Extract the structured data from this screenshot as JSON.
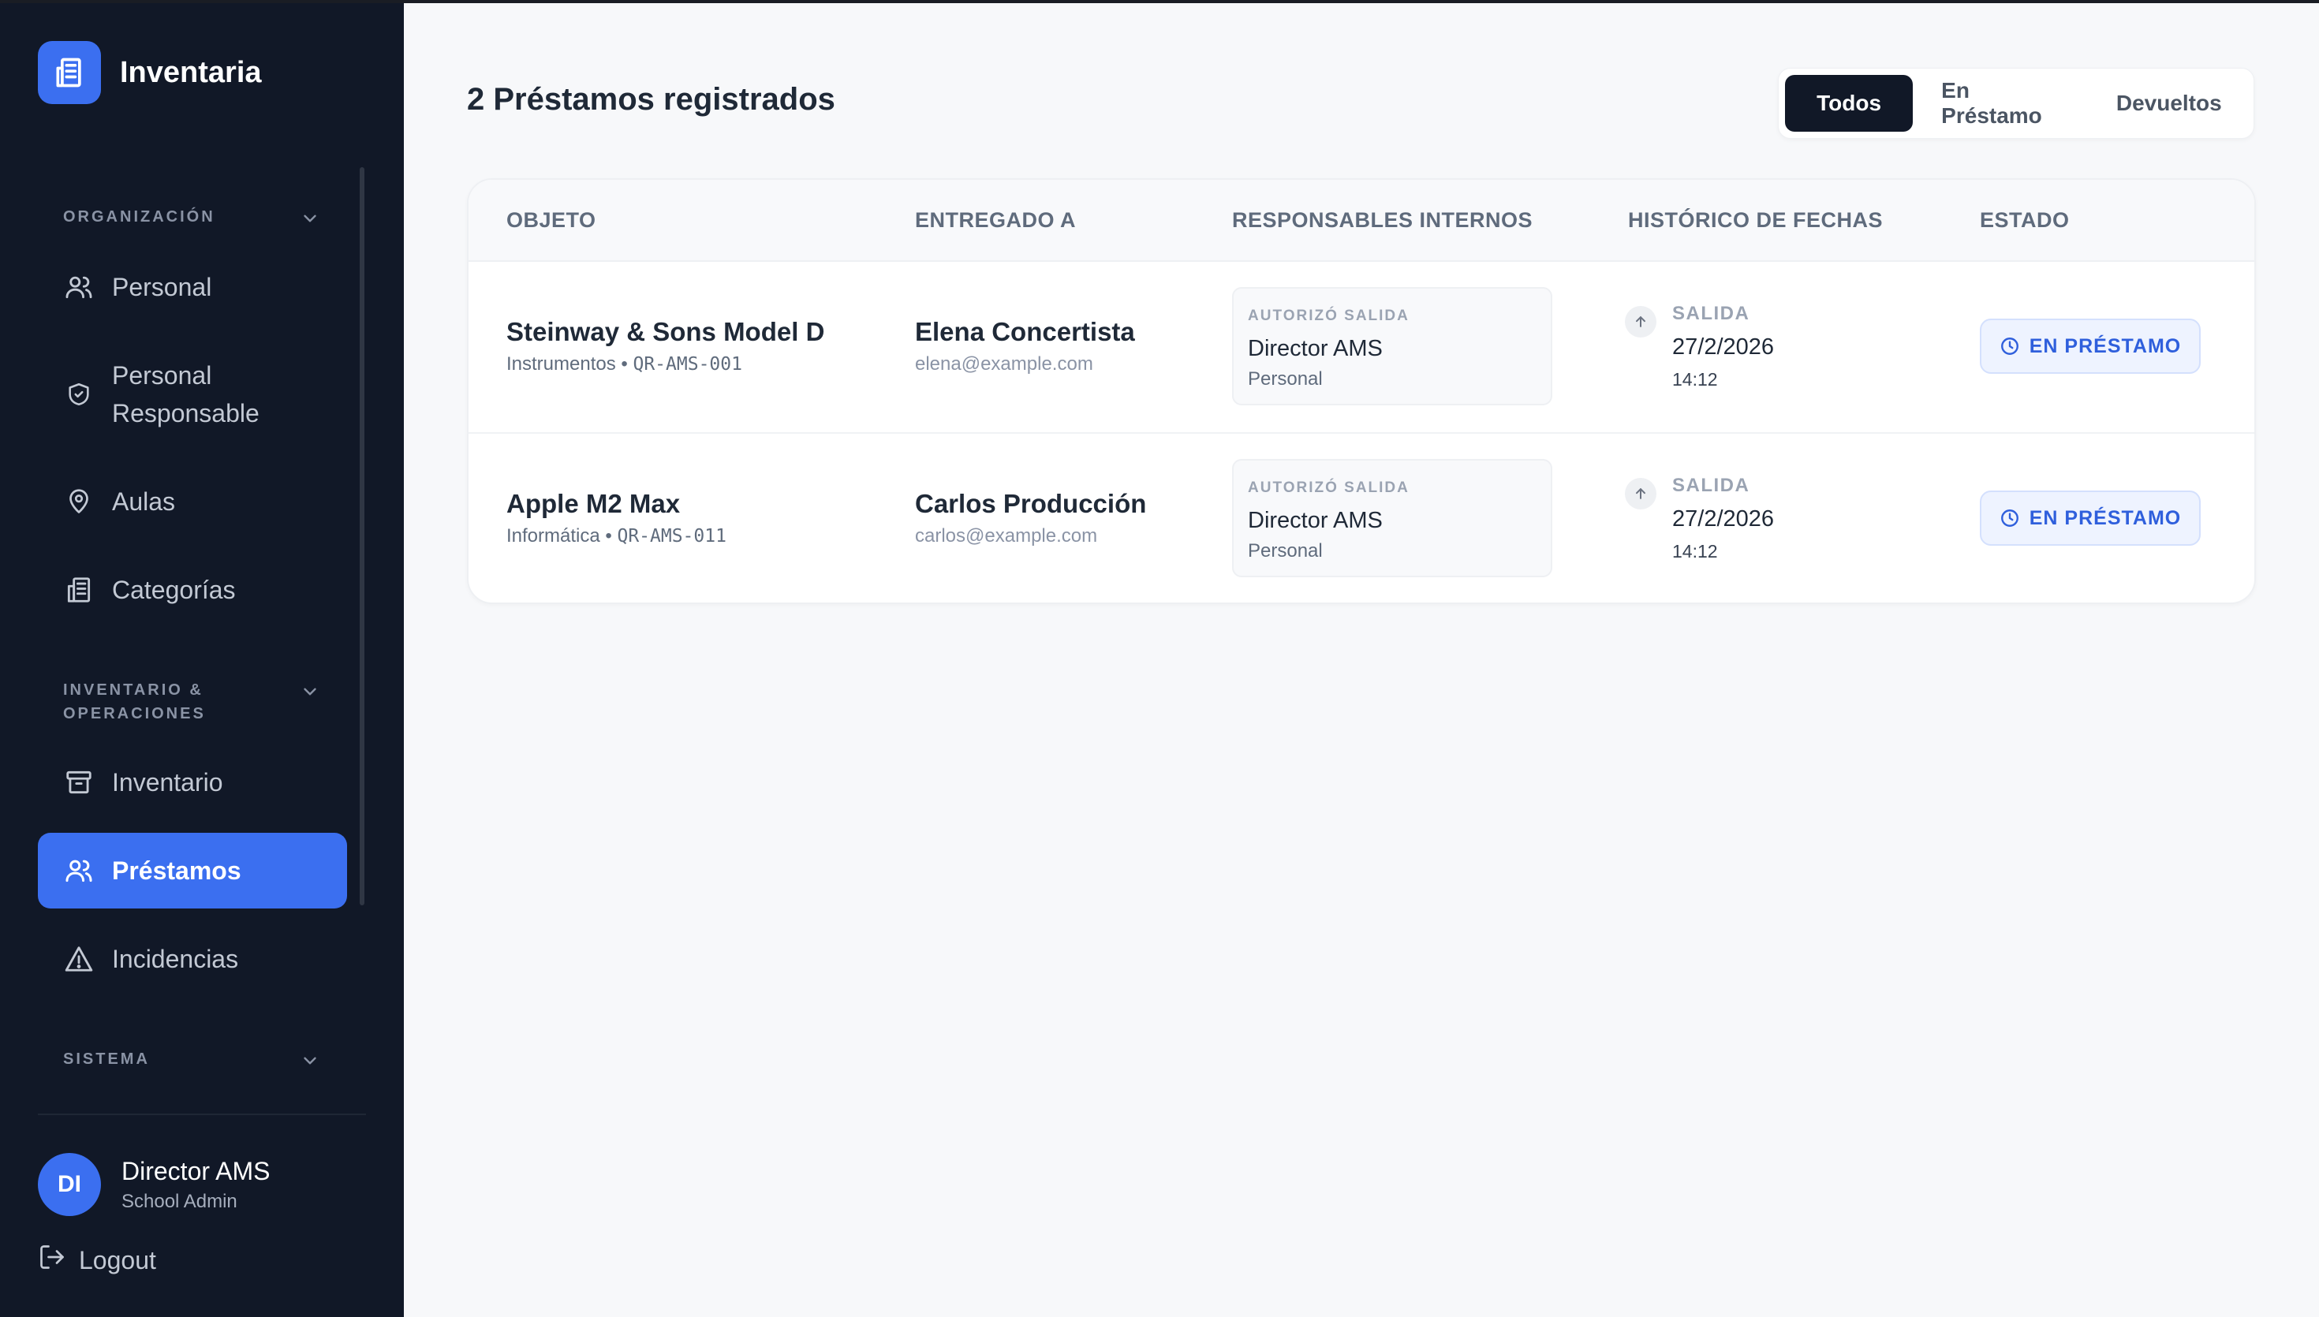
{
  "brand": {
    "name": "Inventaria"
  },
  "sidebar": {
    "sections": [
      {
        "label": "ORGANIZACIÓN"
      },
      {
        "label": "INVENTARIO & OPERACIONES"
      },
      {
        "label": "SISTEMA"
      }
    ],
    "items": [
      {
        "label": "Personal",
        "icon": "users-icon"
      },
      {
        "label": "Personal Responsable",
        "icon": "shield-icon"
      },
      {
        "label": "Aulas",
        "icon": "map-pin-icon"
      },
      {
        "label": "Categorías",
        "icon": "building-icon"
      },
      {
        "label": "Inventario",
        "icon": "archive-icon"
      },
      {
        "label": "Préstamos",
        "icon": "users-icon",
        "active": true
      },
      {
        "label": "Incidencias",
        "icon": "warning-icon"
      }
    ],
    "user": {
      "initials": "DI",
      "name": "Director AMS",
      "role": "School Admin"
    },
    "logout_label": "Logout"
  },
  "main": {
    "title": "2 Préstamos registrados",
    "filters": [
      {
        "label": "Todos",
        "active": true
      },
      {
        "label": "En Préstamo"
      },
      {
        "label": "Devueltos"
      }
    ],
    "table": {
      "headers": [
        "OBJETO",
        "ENTREGADO A",
        "RESPONSABLES INTERNOS",
        "HISTÓRICO DE FECHAS",
        "ESTADO"
      ],
      "rows": [
        {
          "object": "Steinway & Sons Model D",
          "category": "Instrumentos",
          "code": "QR-AMS-001",
          "to_name": "Elena Concertista",
          "to_email": "elena@example.com",
          "resp_label": "AUTORIZÓ SALIDA",
          "resp_name": "Director AMS",
          "resp_role": "Personal",
          "hist_label": "SALIDA",
          "hist_date": "27/2/2026",
          "hist_time": "14:12",
          "status": "EN PRÉSTAMO"
        },
        {
          "object": "Apple M2 Max",
          "category": "Informática",
          "code": "QR-AMS-011",
          "to_name": "Carlos Producción",
          "to_email": "carlos@example.com",
          "resp_label": "AUTORIZÓ SALIDA",
          "resp_name": "Director AMS",
          "resp_role": "Personal",
          "hist_label": "SALIDA",
          "hist_date": "27/2/2026",
          "hist_time": "14:12",
          "status": "EN PRÉSTAMO"
        }
      ]
    }
  },
  "colors": {
    "sidebar_bg": "#111827",
    "accent": "#3b6ff0",
    "status_text": "#2f5fdc",
    "status_bg": "#eef3ff"
  }
}
